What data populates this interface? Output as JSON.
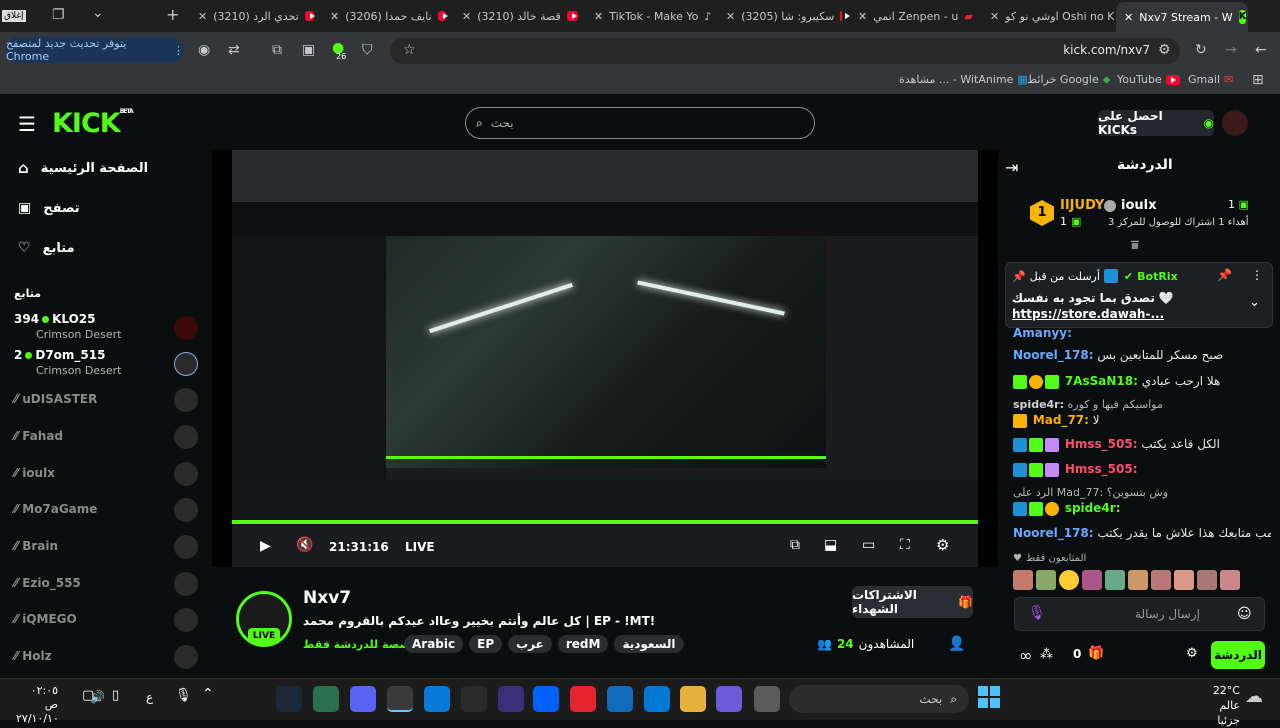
{
  "browser": {
    "tabs": [
      {
        "label": "Nxv7 Stream - W",
        "type": "kick",
        "active": true
      },
      {
        "label": "اوشي نو كو Oshi no Ko",
        "type": "other"
      },
      {
        "label": "انمي Zenpen - u",
        "type": "other"
      },
      {
        "label": "(3205) سكيبرو: شا",
        "type": "youtube"
      },
      {
        "label": "TikTok - Make Yo",
        "type": "tiktok"
      },
      {
        "label": "(3210) قصة خالد",
        "type": "youtube"
      },
      {
        "label": "(3206) نايف حمدا",
        "type": "youtube"
      },
      {
        "label": "(3210) تحدي الرد",
        "type": "youtube"
      }
    ],
    "extra_tab": "إغلاق",
    "url": "kick.com/nxv7",
    "update_label": "يتوفر تحديث جديد لمتصفح Chrome",
    "badge_count": "26",
    "bookmarks": [
      "Gmail",
      "YouTube",
      "خرائط Google",
      "مشاهدة ... - WitAnime"
    ]
  },
  "kick": {
    "logo": "KICK",
    "beta": "BETA",
    "search_placeholder": "بحث",
    "get_kicks": "احصل على KICKs"
  },
  "sidebar": {
    "nav": [
      "الصفحة الرئيسية",
      "تصفح",
      "متابع"
    ],
    "following_header": "متابع",
    "live_channels": [
      {
        "viewers": "394",
        "name": "KLO25",
        "game": "Crimson Desert"
      },
      {
        "viewers": "2",
        "name": "D7om_515",
        "game": "Crimson Desert"
      }
    ],
    "offline_channels": [
      "uDISASTER",
      "Fahad",
      "ioulx",
      "Mo7aGame",
      "Brain",
      "Ezio_555",
      "iQMEGO",
      "Holz"
    ]
  },
  "player": {
    "time": "21:31:16",
    "live": "LIVE"
  },
  "stream": {
    "channel": "Nxv7",
    "title": "كل عالم وأنتم بخيير وعااد عيدكم بالقروم محمد | EP - !MT!",
    "category": "مخصصة للدردشة فقط",
    "tags": [
      "السعودية",
      "redM",
      "عرب",
      "EP",
      "Arabic"
    ],
    "viewers_label": "المشاهدون",
    "viewers": "24",
    "subscribe_gift": "الاشتراكات الشهداء",
    "live_badge": "LIVE"
  },
  "chat": {
    "title": "الدردشة",
    "pinned_user": "IIJUDY",
    "pinned_rank": "1",
    "pinned_count": "1",
    "gifter_user": "ioulx",
    "gifter_note": "أهداء 1 اشتراك للوصول للمركز 3",
    "pinned_msg": {
      "from_label": "أرسلت من قبل",
      "bot": "BotRix",
      "text": "تصدق بما تجود به نفسك",
      "link": "https://store.dawah-..."
    },
    "messages": [
      {
        "user": "Amanyy:",
        "text": "",
        "color": "#6ba8ff"
      },
      {
        "user": "Noorel_178:",
        "text": "صبح مسكر للمتابعين بس",
        "color": "#6ba8ff"
      },
      {
        "user": "7AsSaN18:",
        "text": "هلا ارحب عبادي",
        "color": "#53fc18"
      },
      {
        "user": "spide4r:",
        "text": "مواسيكم فيها و كوره",
        "color": "#d0d0d0"
      },
      {
        "user": "Mad_77:",
        "text": "لا",
        "color": "#ffae00"
      },
      {
        "user": "Hmss_505:",
        "text": "الكل قاعد يكتب",
        "color": "#ff4d6d"
      },
      {
        "user": "Hmss_505:",
        "text": "",
        "color": "#ff4d6d"
      },
      {
        "user": "spide4r:",
        "text": "",
        "color": "#53fc18"
      },
      {
        "user": "Noorel_178:",
        "text": "هو مب متابعك هذا علاش ما يقدر يكتب",
        "color": "#6ba8ff"
      }
    ],
    "reply_mad": "الرد على Mad_77: وش بتسوين؟",
    "reply_spider": "الرد على spide4r:",
    "followers_only": "المتابعون فقط",
    "input_placeholder": "إرسال رسالة",
    "points": "0",
    "send": "الدردشة"
  },
  "taskbar": {
    "search": "بحث",
    "weather_temp": "22°C",
    "weather_desc": "عالم جزئيا",
    "time": "٠٢:٠٥ ص",
    "date": "٢٧/١٠/١٠",
    "lang": "ع"
  }
}
